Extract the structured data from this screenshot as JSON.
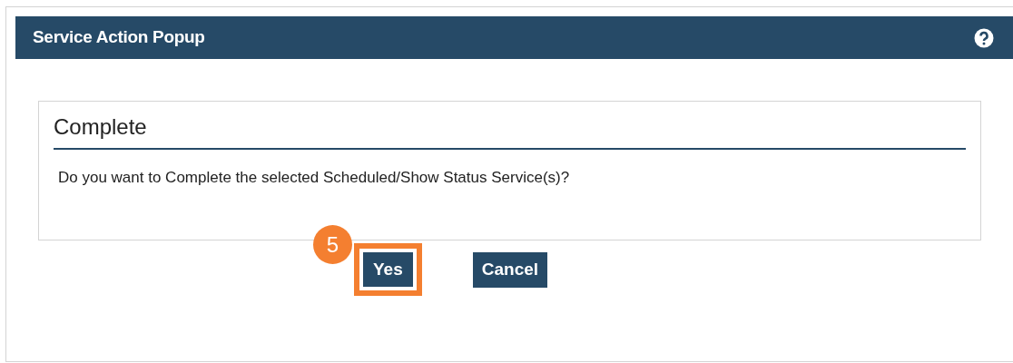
{
  "dialog": {
    "title": "Service Action Popup"
  },
  "section": {
    "title": "Complete",
    "message": "Do you want to Complete the selected Scheduled/Show Status Service(s)?"
  },
  "step_badge": "5",
  "buttons": [
    {
      "label": "Yes",
      "highlighted": true
    },
    {
      "label": "Cancel",
      "highlighted": false
    }
  ]
}
